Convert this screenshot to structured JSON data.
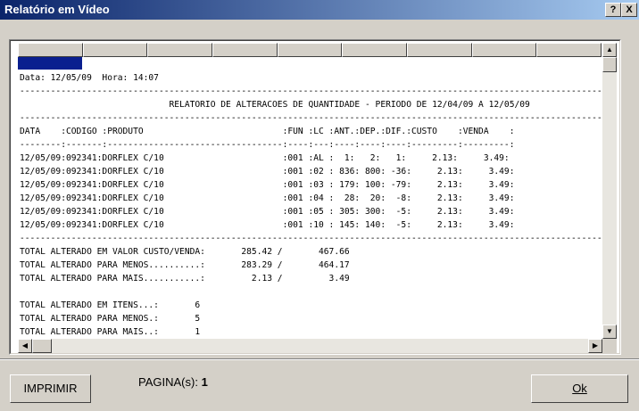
{
  "window": {
    "title": "Relatório em Vídeo",
    "help_glyph": "?",
    "close_glyph": "X"
  },
  "report": {
    "header_line": "Data: 12/05/09  Hora: 14:07",
    "separator_top": "-------------------------------------------------------------------------------------------------------------------------",
    "title_line": "                             RELATORIO DE ALTERACOES DE QUANTIDADE - PERIODO DE 12/04/09 A 12/05/09",
    "separator_mid": "-------------------------------------------------------------------------------------------------------------------------",
    "column_header": "DATA    :CODIGO :PRODUTO                           :FUN :LC :ANT.:DEP.:DIF.:CUSTO    :VENDA    :",
    "column_separator": "--------:-------:----------------------------------:----:---:----:----:----:---------:---------:",
    "rows": [
      "12/05/09:092341:DORFLEX C/10                       :001 :AL :  1:   2:   1:     2.13:     3.49:",
      "12/05/09:092341:DORFLEX C/10                       :001 :02 : 836: 800: -36:     2.13:     3.49:",
      "12/05/09:092341:DORFLEX C/10                       :001 :03 : 179: 100: -79:     2.13:     3.49:",
      "12/05/09:092341:DORFLEX C/10                       :001 :04 :  28:  20:  -8:     2.13:     3.49:",
      "12/05/09:092341:DORFLEX C/10                       :001 :05 : 305: 300:  -5:     2.13:     3.49:",
      "12/05/09:092341:DORFLEX C/10                       :001 :10 : 145: 140:  -5:     2.13:     3.49:"
    ],
    "separator_bottom": "-------------------------------------------------------------------------------------------------------------------------",
    "totals": [
      "TOTAL ALTERADO EM VALOR CUSTO/VENDA:       285.42 /       467.66",
      "TOTAL ALTERADO PARA MENOS..........:       283.29 /       464.17",
      "TOTAL ALTERADO PARA MAIS...........:         2.13 /         3.49",
      "",
      "TOTAL ALTERADO EM ITENS...:       6",
      "TOTAL ALTERADO PARA MENOS.:       5",
      "TOTAL ALTERADO PARA MAIS..:       1"
    ]
  },
  "footer": {
    "print_button": "IMPRIMIR",
    "pagina_label": "PAGINA(s):",
    "pagina_value": "1",
    "ok_button": "Ok"
  },
  "icons": {
    "up": "▲",
    "down": "▼",
    "left": "◀",
    "right": "▶"
  },
  "colors": {
    "titlebar_start": "#0a246a",
    "titlebar_end": "#a6caf0",
    "selection_block": "#0a1f8f",
    "face": "#d4d0c8"
  }
}
